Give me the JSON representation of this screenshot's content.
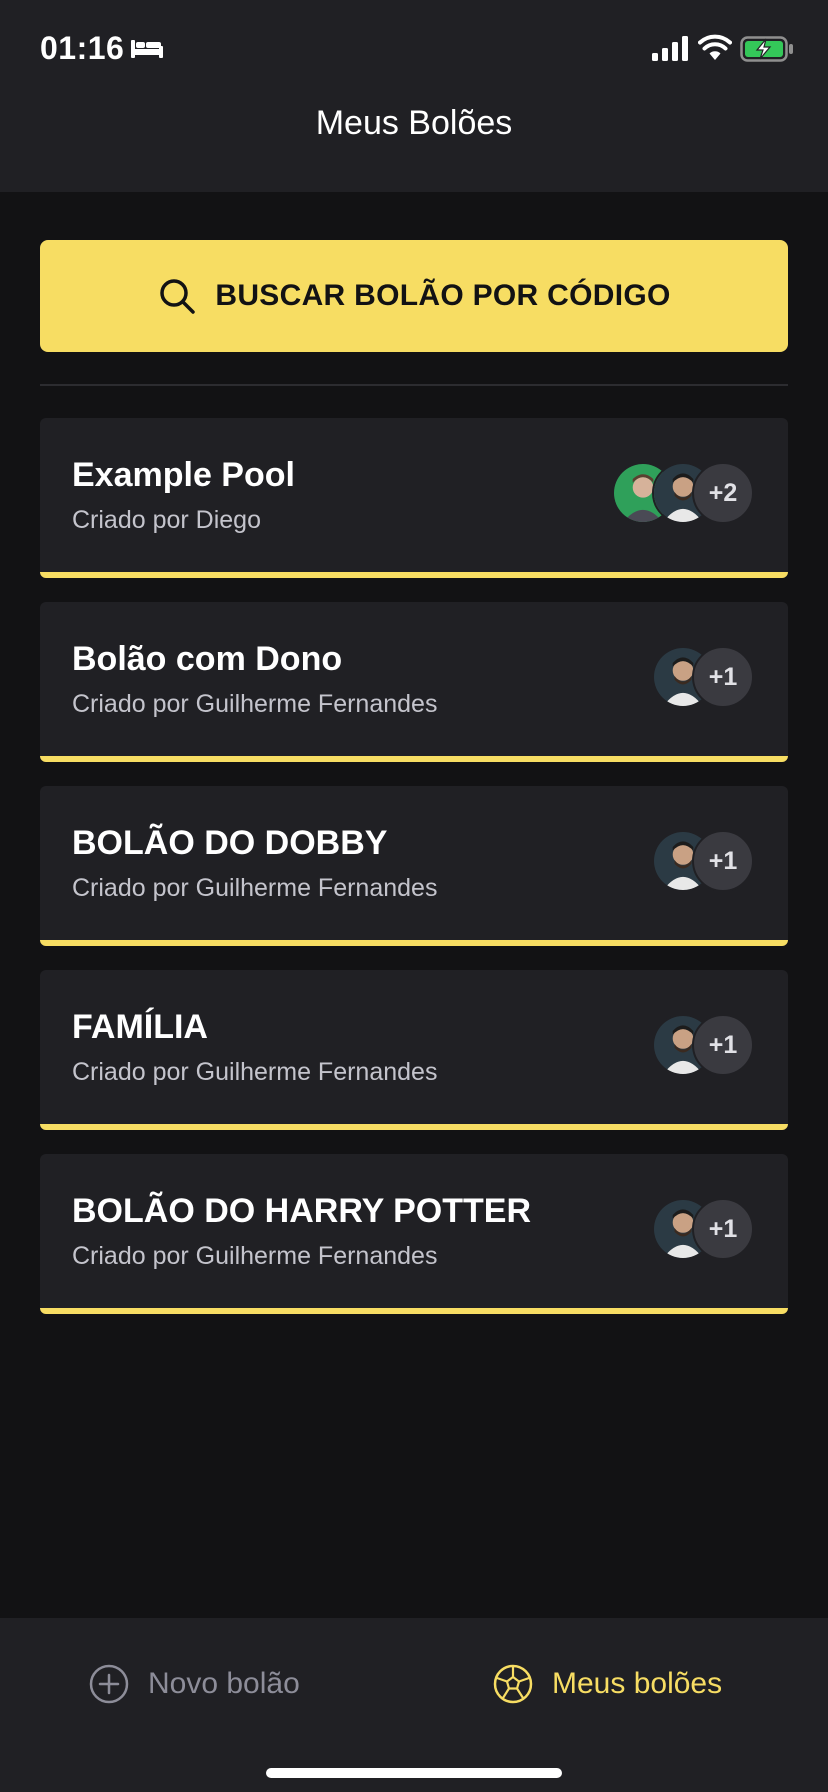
{
  "status_bar": {
    "time": "01:16"
  },
  "header": {
    "title": "Meus Bolões"
  },
  "search": {
    "label": "BUSCAR BOLÃO POR CÓDIGO"
  },
  "pools": [
    {
      "title": "Example Pool",
      "owner": "Criado por Diego",
      "more": "+2"
    },
    {
      "title": "Bolão com Dono",
      "owner": "Criado por Guilherme Fernandes",
      "more": "+1"
    },
    {
      "title": "BOLÃO DO DOBBY",
      "owner": "Criado por Guilherme Fernandes",
      "more": "+1"
    },
    {
      "title": "FAMÍLIA",
      "owner": "Criado por Guilherme Fernandes",
      "more": "+1"
    },
    {
      "title": "BOLÃO DO HARRY POTTER",
      "owner": "Criado por Guilherme Fernandes",
      "more": "+1"
    }
  ],
  "tabbar": {
    "new_label": "Novo bolão",
    "mine_label": "Meus bolões"
  },
  "colors": {
    "accent": "#F7DD63",
    "background": "#121214",
    "surface": "#202024",
    "muted_text": "#C4C4CC"
  },
  "icons": [
    "bed-icon",
    "cellular-signal-icon",
    "wifi-icon",
    "battery-charging-icon",
    "search-icon",
    "plus-circle-icon",
    "soccer-ball-icon"
  ]
}
